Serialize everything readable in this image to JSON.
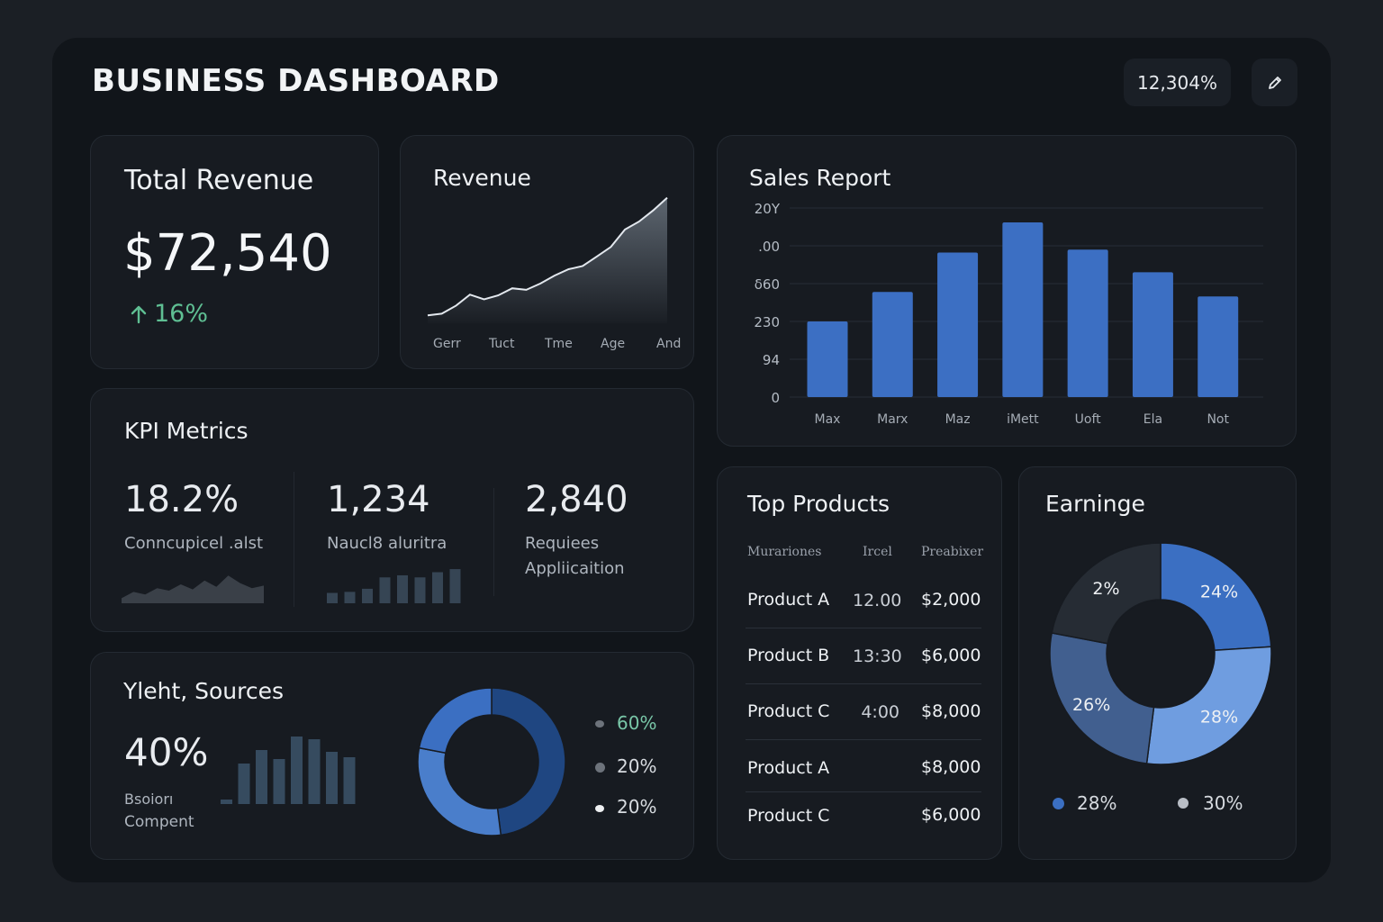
{
  "header": {
    "title": "BUSINESS DASHBOARD",
    "stat_pill": "12,304%",
    "edit_icon": "pencil-icon"
  },
  "total_revenue": {
    "title": "Total Revenue",
    "value": "$72,540",
    "change": "16%",
    "change_icon": "arrow-up-icon",
    "accent": "#5fbf93"
  },
  "revenue_chart": {
    "title": "Revenue",
    "x_labels": [
      "Gerr",
      "Tuct",
      "Tme",
      "Age",
      "And"
    ]
  },
  "sales_report": {
    "title": "Sales Report"
  },
  "kpi": {
    "title": "KPI Metrics",
    "items": [
      {
        "value": "18.2%",
        "label_1": "Conncupicel .alst",
        "label_2": ""
      },
      {
        "value": "1,234",
        "label_1": "Naucl8 aluritra",
        "label_2": ""
      },
      {
        "value": "2,840",
        "label_1": "Requiees",
        "label_2": "Appliicaition"
      }
    ]
  },
  "yield_sources": {
    "title": "Yleht, Sources",
    "value": "40%",
    "label_1": "Bsoiorı",
    "label_2": "Compent",
    "legend": [
      {
        "label": "60%",
        "color": "#79c7a8"
      },
      {
        "label": "20%",
        "color": "#d7dbe0"
      },
      {
        "label": "20%",
        "color": "#d7dbe0"
      }
    ]
  },
  "top_products": {
    "title": "Top Products",
    "headers": [
      "Murariones",
      "Ircel",
      "Preabixer"
    ],
    "rows": [
      {
        "name": "Product A",
        "qty": "12.00",
        "amount": "$2,000"
      },
      {
        "name": "Product B",
        "qty": "13:30",
        "amount": "$6,000"
      },
      {
        "name": "Product C",
        "qty": "4:00",
        "amount": "$8,000"
      },
      {
        "name": "Product A",
        "qty": "",
        "amount": "$8,000"
      },
      {
        "name": "Product C",
        "qty": "",
        "amount": "$6,000"
      }
    ]
  },
  "earnings": {
    "title": "Earninge",
    "legend": [
      {
        "label": "28%",
        "color": "#3b6fc2"
      },
      {
        "label": "30%",
        "color": "#b9bec6"
      }
    ]
  },
  "chart_data": [
    {
      "type": "area",
      "title": "Revenue",
      "categories": [
        "Gerr",
        "Tuct",
        "Tme",
        "Age",
        "And"
      ],
      "y": [
        10,
        12,
        22,
        36,
        30,
        35,
        44,
        42,
        50,
        60,
        68,
        72,
        84,
        96,
        118,
        128,
        142,
        158
      ],
      "ylim": [
        0,
        170
      ],
      "grid": false,
      "colors": {
        "line": "#e3e8ee",
        "fill_top": "#5d6670",
        "fill_bottom": "#1a1e24"
      }
    },
    {
      "type": "bar",
      "title": "Sales Report",
      "categories": [
        "Max",
        "Marx",
        "Maz",
        "iMett",
        "Uoft",
        "Ela",
        "Not"
      ],
      "values": [
        200,
        278,
        382,
        462,
        390,
        330,
        266
      ],
      "y_tick_labels": [
        "0",
        "94",
        "230",
        "δ60",
        ".00",
        "20Y"
      ],
      "ylim": [
        0,
        500
      ],
      "grid": true,
      "color": "#3c6fc3"
    },
    {
      "type": "area",
      "title": "Conncupicel .alst",
      "y": [
        4,
        9,
        7,
        12,
        10,
        15,
        11,
        18,
        13,
        22,
        16,
        12,
        14
      ],
      "ylim": [
        0,
        30
      ],
      "color": "#3a4048"
    },
    {
      "type": "bar",
      "title": "Naucl8 aluritra",
      "values": [
        10,
        11,
        14,
        25,
        27,
        25,
        30,
        33
      ],
      "ylim": [
        0,
        40
      ],
      "color": "#364554"
    },
    {
      "type": "bar",
      "title": "Yleht, Sources",
      "values": [
        5,
        45,
        60,
        50,
        75,
        72,
        58,
        52
      ],
      "ylim": [
        0,
        80
      ],
      "color": "#364b5f"
    },
    {
      "type": "pie",
      "title": "Yleht, Sources",
      "labels": [
        "60%",
        "20%",
        "20%"
      ],
      "values": [
        48,
        30,
        22
      ],
      "colors": [
        "#1f4681",
        "#4a7ecb",
        "#3b6fc2"
      ]
    },
    {
      "type": "pie",
      "title": "Earninge",
      "labels": [
        "24%",
        "28%",
        "26%",
        "2%"
      ],
      "values": [
        24,
        28,
        26,
        22
      ],
      "colors": [
        "#3b6fc2",
        "#6f9de0",
        "#415f8f",
        "#262c34"
      ]
    }
  ]
}
